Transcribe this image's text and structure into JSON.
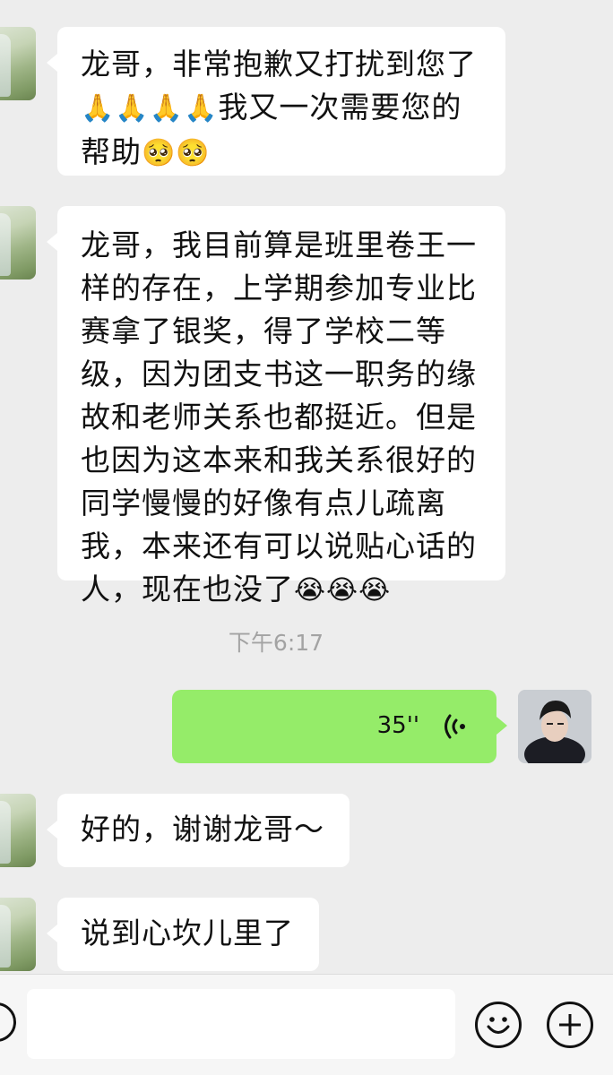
{
  "messages": [
    {
      "sender": "contact",
      "text": "龙哥，非常抱歉又打扰到您了",
      "line2_text": "我又一次需要您的",
      "line3_text": "帮助",
      "emoji_pray": "🙏🙏🙏🙏",
      "emoji_plead": "🥺🥺"
    },
    {
      "sender": "contact",
      "lines": [
        "龙哥，我目前算是班里卷王一",
        "样的存在，上学期参加专业比",
        "赛拿了银奖，得了学校二等",
        "级，因为团支书这一职务的缘",
        "故和老师关系也都挺近。但是",
        "也因为这本来和我关系很好的",
        "同学慢慢的好像有点儿疏离",
        "我，本来还有可以说贴心话的",
        "人，现在也没了"
      ],
      "emoji_cry": "😭😭😭"
    },
    {
      "sender": "me",
      "type": "voice",
      "duration": "35''"
    },
    {
      "sender": "contact",
      "text": "好的，谢谢龙哥～"
    },
    {
      "sender": "contact",
      "text": "说到心坎儿里了"
    }
  ],
  "timestamp": "下午6:17",
  "input": {
    "placeholder": ""
  },
  "icons": {
    "voice": "voice-wave-icon",
    "emoji": "smile-icon",
    "plus": "plus-icon"
  },
  "colors": {
    "background": "#ededed",
    "bubble_in": "#ffffff",
    "bubble_out": "#95ec69"
  }
}
